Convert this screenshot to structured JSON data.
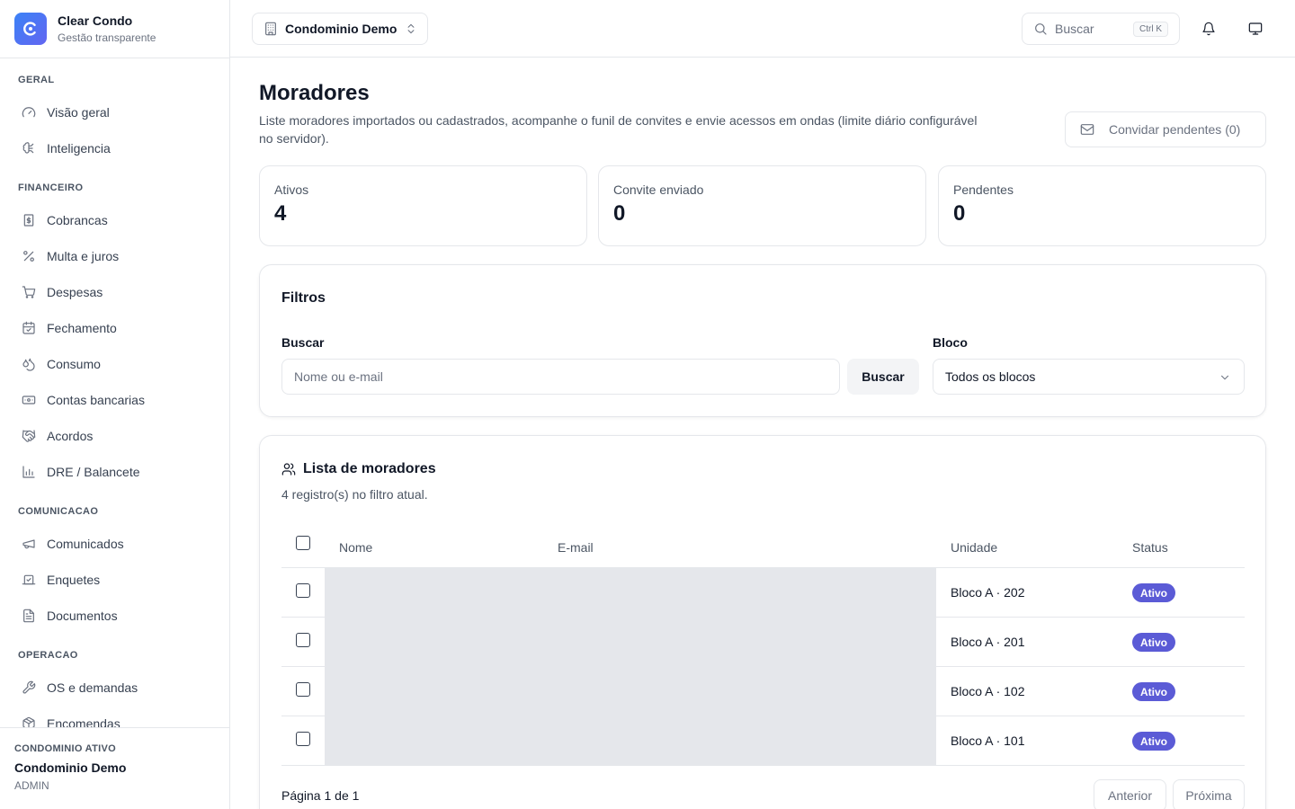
{
  "brand": {
    "name": "Clear Condo",
    "tagline": "Gestão transparente"
  },
  "sidebar": {
    "sections": [
      {
        "title": "GERAL",
        "items": [
          {
            "label": "Visão geral",
            "icon": "gauge-icon"
          },
          {
            "label": "Inteligencia",
            "icon": "brain-icon"
          }
        ]
      },
      {
        "title": "FINANCEIRO",
        "items": [
          {
            "label": "Cobrancas",
            "icon": "receipt-icon"
          },
          {
            "label": "Multa e juros",
            "icon": "percent-icon"
          },
          {
            "label": "Despesas",
            "icon": "cart-icon"
          },
          {
            "label": "Fechamento",
            "icon": "calendar-check-icon"
          },
          {
            "label": "Consumo",
            "icon": "droplets-icon"
          },
          {
            "label": "Contas bancarias",
            "icon": "banknote-icon"
          },
          {
            "label": "Acordos",
            "icon": "handshake-icon"
          },
          {
            "label": "DRE / Balancete",
            "icon": "bar-chart-icon"
          }
        ]
      },
      {
        "title": "COMUNICACAO",
        "items": [
          {
            "label": "Comunicados",
            "icon": "megaphone-icon"
          },
          {
            "label": "Enquetes",
            "icon": "vote-icon"
          },
          {
            "label": "Documentos",
            "icon": "file-text-icon"
          }
        ]
      },
      {
        "title": "OPERACAO",
        "items": [
          {
            "label": "OS e demandas",
            "icon": "wrench-icon"
          },
          {
            "label": "Encomendas",
            "icon": "package-icon"
          }
        ]
      }
    ],
    "footer": {
      "label": "CONDOMINIO ATIVO",
      "name": "Condominio Demo",
      "role": "ADMIN"
    }
  },
  "header": {
    "condo_selector": "Condominio Demo",
    "search_label": "Buscar",
    "search_shortcut": "Ctrl K"
  },
  "page": {
    "title": "Moradores",
    "description": "Liste moradores importados ou cadastrados, acompanhe o funil de convites e envie acessos em ondas (limite diário configurável no servidor).",
    "invite_button": "Convidar pendentes (0)"
  },
  "stats": [
    {
      "label": "Ativos",
      "value": "4"
    },
    {
      "label": "Convite enviado",
      "value": "0"
    },
    {
      "label": "Pendentes",
      "value": "0"
    }
  ],
  "filters": {
    "title": "Filtros",
    "search_label": "Buscar",
    "search_placeholder": "Nome ou e-mail",
    "search_button": "Buscar",
    "block_label": "Bloco",
    "block_value": "Todos os blocos"
  },
  "list": {
    "title": "Lista de moradores",
    "subtitle": "4 registro(s) no filtro atual.",
    "columns": {
      "name": "Nome",
      "email": "E-mail",
      "unit": "Unidade",
      "status": "Status"
    },
    "rows": [
      {
        "unit": "Bloco A · 202",
        "status": "Ativo"
      },
      {
        "unit": "Bloco A · 201",
        "status": "Ativo"
      },
      {
        "unit": "Bloco A · 102",
        "status": "Ativo"
      },
      {
        "unit": "Bloco A · 101",
        "status": "Ativo"
      }
    ],
    "pagination": {
      "text": "Página 1 de 1",
      "prev": "Anterior",
      "next": "Próxima"
    }
  },
  "colors": {
    "accent": "#5b5bd6",
    "brand_gradient_start": "#3b82f6",
    "brand_gradient_end": "#6366f1"
  }
}
